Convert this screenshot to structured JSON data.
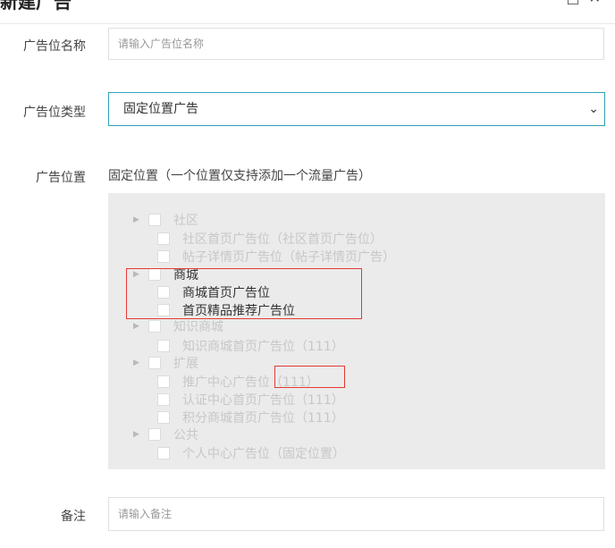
{
  "dialog": {
    "title": "新建广告"
  },
  "fields": {
    "name_label": "广告位名称",
    "name_placeholder": "请输入广告位名称",
    "type_label": "广告位类型",
    "type_value": "固定位置广告",
    "position_label": "广告位置",
    "position_hint": "固定位置（一个位置仅支持添加一个流量广告）",
    "remark_label": "备注",
    "remark_placeholder": "请输入备注"
  },
  "tree": [
    {
      "label": "社区",
      "level": 0
    },
    {
      "label": "社区首页广告位（社区首页广告位）",
      "level": 1
    },
    {
      "label": "帖子详情页广告位（帖子详情页广告）",
      "level": 1
    },
    {
      "label": "商城",
      "level": 0
    },
    {
      "label": "商城首页广告位",
      "level": 1
    },
    {
      "label": "首页精品推荐广告位",
      "level": 1
    },
    {
      "label": "知识商城",
      "level": 0
    },
    {
      "label": "知识商城首页广告位（111）",
      "level": 1
    },
    {
      "label": "扩展",
      "level": 0
    },
    {
      "label": "推广中心广告位（111）",
      "level": 1
    },
    {
      "label": "认证中心首页广告位（111）",
      "level": 1
    },
    {
      "label": "积分商城首页广告位（111）",
      "level": 1
    },
    {
      "label": "公共",
      "level": 0
    },
    {
      "label": "个人中心广告位（固定位置）",
      "level": 1
    }
  ]
}
